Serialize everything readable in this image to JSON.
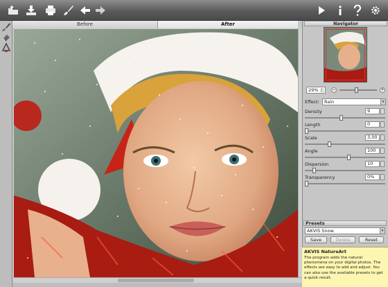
{
  "toolbar": {
    "left_icons": [
      "open-folder-icon",
      "save-download-icon",
      "print-icon",
      "brush-icon",
      "back-arrow-icon",
      "forward-arrow-icon"
    ],
    "right_icons": [
      "play-icon",
      "info-icon",
      "help-icon",
      "settings-gear-icon"
    ]
  },
  "left_tools": [
    "retouch-brush-icon",
    "eraser-icon",
    "history-brush-icon"
  ],
  "tabs": {
    "before": "Before",
    "after": "After"
  },
  "navigator": {
    "title": "Navigator"
  },
  "zoom": {
    "value": "29%"
  },
  "effect": {
    "label": "Effect:",
    "value": "Rain"
  },
  "params": [
    {
      "label": "Density",
      "value": "9",
      "level": 0.45
    },
    {
      "label": "Length",
      "value": "0",
      "level": 0.0
    },
    {
      "label": "Scale",
      "value": "3,00",
      "level": 0.3
    },
    {
      "label": "Angle",
      "value": "100",
      "level": 0.55
    },
    {
      "label": "Dispersion",
      "value": "10",
      "level": 0.1
    },
    {
      "label": "Transparency",
      "value": "0%",
      "level": 0.0
    }
  ],
  "presets": {
    "title": "Presets",
    "selected": "AKVIS Snow",
    "save": "Save",
    "delete": "Delete",
    "reset": "Reset"
  },
  "help": {
    "title": "AKVIS NatureArt",
    "text": "The program adds the natural phenomena on your digital photos. The effects are easy to add and adjust. You can also use the available presets to get a quick result."
  },
  "colors": {
    "accent": "#e03030",
    "toolbar": "#5a5a5a",
    "help_bg": "#fdf6b0"
  }
}
